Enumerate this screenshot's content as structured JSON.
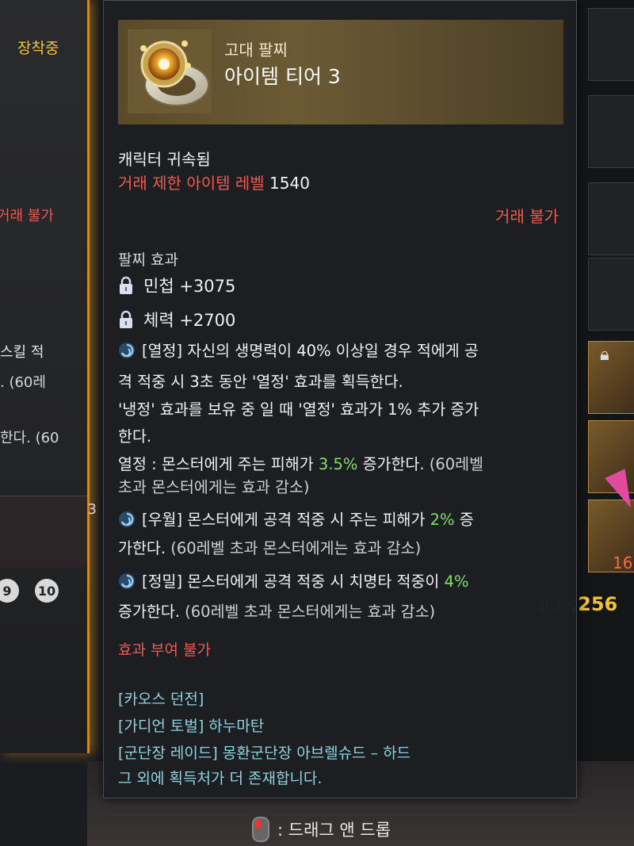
{
  "background": {
    "left_panel": {
      "equipped_label": "장착중",
      "untradable_label": "거래 불가",
      "fragment_1": " 스킬 적",
      "fragment_2": ". (60레",
      "fragment_3": "한다. (60",
      "slot_count": "3",
      "slot_numbers": [
        "9",
        "10"
      ]
    },
    "right_panel": {
      "gold_prefix": "99",
      "gold_amount": ",256",
      "stack_count": "16"
    },
    "drag_hint": ": 드래그 앤 드롭"
  },
  "tooltip": {
    "item_type": "고대 팔찌",
    "item_tier": "아이템 티어 3",
    "icon": "bracelet-icon",
    "bound": "캐릭터 귀속됨",
    "trade_restrict_label": "거래 제한 아이템 레벨",
    "trade_restrict_level": "1540",
    "trade_status": "거래 불가",
    "effects_title": "팔찌 효과",
    "stats": [
      {
        "icon": "lock-icon",
        "text": "민첩 +3075"
      },
      {
        "icon": "lock-icon",
        "text": "체력 +2700"
      }
    ],
    "effect_passion": {
      "line1": "[열정] 자신의 생명력이 40% 이상일 경우 적에게 공",
      "line2": "격 적중 시 3초 동안 '열정' 효과를 획득한다.",
      "line3": "'냉정' 효과를 보유 중 일 때 '열정' 효과가 1% 추가 증가",
      "line4": "한다.",
      "line5_pre": "열정 : 몬스터에게 주는 피해가 ",
      "line5_val": "3.5%",
      "line5_post": " 증가한다.",
      "line5_tail": " (60레벨",
      "line6": "초과 몬스터에게는 효과 감소)"
    },
    "effect_superiority": {
      "line1_pre": "[우월] 몬스터에게 공격 적중 시 주는 피해가 ",
      "line1_val": "2%",
      "line1_post": " 증",
      "line2_pre": "가한다.",
      "line2_tail": " (60레벨 초과 몬스터에게는 효과 감소)"
    },
    "effect_precision": {
      "line1_pre": "[정밀] 몬스터에게 공격 적중 시 치명타 적중이 ",
      "line1_val": "4%",
      "line2_pre": "증가한다.",
      "line2_tail": " (60레벨 초과 몬스터에게는 효과 감소)"
    },
    "enchant_status": "효과 부여 불가",
    "sources": [
      "[카오스 던전]",
      "[가디언 토벌] 하누마탄",
      "[군단장 레이드] 몽환군단장 아브렐슈드 – 하드",
      "그 외에 획득처가 더 존재합니다."
    ]
  },
  "colors": {
    "red": "#ee5a4e",
    "green": "#7ee06a",
    "cyan": "#8fd3e0",
    "gold": "#f0c23a"
  }
}
